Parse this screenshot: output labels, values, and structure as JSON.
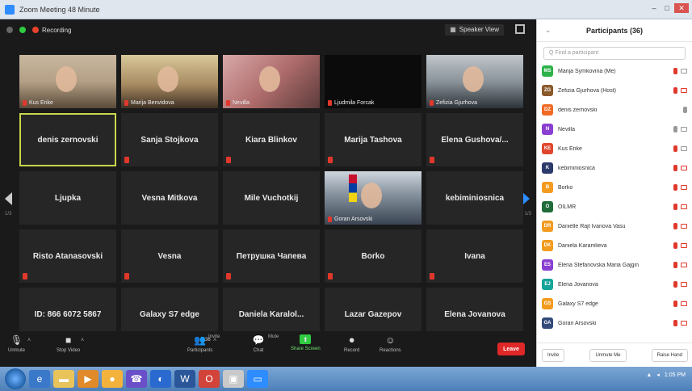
{
  "window": {
    "title": "Zoom Meeting 48 Minute"
  },
  "top": {
    "recording_label": "Recording",
    "speaker_view_label": "Speaker View"
  },
  "tiles": [
    {
      "name": "Kus Erike",
      "type": "video"
    },
    {
      "name": "Marija Benvidova",
      "type": "video"
    },
    {
      "name": "Nevilla",
      "type": "video"
    },
    {
      "name": "Ljudmila Forcak",
      "type": "video"
    },
    {
      "name": "Zefizia Gjurhova",
      "type": "video"
    },
    {
      "name": "denis zernovski",
      "type": "name",
      "active": true
    },
    {
      "name": "Sanja Stojkova",
      "type": "name",
      "muted": true
    },
    {
      "name": "Kiara Blinkov",
      "type": "name",
      "muted": true
    },
    {
      "name": "Marija Tashova",
      "type": "name",
      "muted": true
    },
    {
      "name": "Elena Gushova/...",
      "type": "name",
      "muted": true
    },
    {
      "name": "Ljupka",
      "type": "name"
    },
    {
      "name": "Vesna Mitkova",
      "type": "name"
    },
    {
      "name": "Mile Vuchotkij",
      "type": "name"
    },
    {
      "name": "Goran Arsovski",
      "type": "video"
    },
    {
      "name": "kebiminiosnica",
      "type": "name"
    },
    {
      "name": "Risto Atanasovski",
      "type": "name",
      "muted": true
    },
    {
      "name": "Vesna",
      "type": "name",
      "muted": true
    },
    {
      "name": "Петрушка Чапева",
      "type": "name",
      "muted": true
    },
    {
      "name": "Borko",
      "type": "name",
      "muted": true
    },
    {
      "name": "Ivana",
      "type": "name",
      "muted": true
    },
    {
      "name": "ID: 866 6072 5867",
      "type": "name",
      "muted": true
    },
    {
      "name": "Galaxy S7 edge",
      "type": "name",
      "muted": true
    },
    {
      "name": "Daniela Karalol...",
      "type": "name",
      "muted": true
    },
    {
      "name": "Lazar Gazepov",
      "type": "name",
      "muted": true
    },
    {
      "name": "Elena Jovanova",
      "type": "name",
      "muted": true
    }
  ],
  "pages": {
    "left": "1/3",
    "right": "1/3"
  },
  "toolbar": {
    "unmute": "Unmute",
    "stop_video": "Stop Video",
    "participants": "Participants",
    "participants_count": "36",
    "chat": "Chat",
    "share_screen": "Share Screen",
    "record": "Record",
    "reactions": "Reactions",
    "leave": "Leave",
    "hint_left": "Invite",
    "hint_right": "Mute"
  },
  "panel": {
    "title": "Participants (36)",
    "search_placeholder": "Q Find a participant",
    "participants": [
      {
        "name": "Marija Symkovina (Me)",
        "initials": "MS",
        "color": "#2db34a",
        "mic": "off",
        "cam": "on"
      },
      {
        "name": "Zefizia Gjurhova (Host)",
        "initials": "ZG",
        "color": "#8b5a2b",
        "mic": "off",
        "cam": "off",
        "photo": true
      },
      {
        "name": "denis zernovski",
        "initials": "DZ",
        "color": "#f06a24",
        "mic": "on",
        "cam": "none"
      },
      {
        "name": "Nevilla",
        "initials": "N",
        "color": "#8a3fd1",
        "mic": "on",
        "cam": "on"
      },
      {
        "name": "Kus Erike",
        "initials": "KE",
        "color": "#e0462c",
        "mic": "off",
        "cam": "on"
      },
      {
        "name": "kebiminiosnica",
        "initials": "K",
        "color": "#2b3a6b",
        "mic": "off",
        "cam": "off"
      },
      {
        "name": "Borko",
        "initials": "B",
        "color": "#f29b1f",
        "mic": "off",
        "cam": "off"
      },
      {
        "name": "OILMR",
        "initials": "O",
        "color": "#1f6b3a",
        "mic": "off",
        "cam": "off",
        "photo": true
      },
      {
        "name": "Danielle Rajt Ivanova Vasu",
        "initials": "DR",
        "color": "#f29b1f",
        "mic": "off",
        "cam": "off"
      },
      {
        "name": "Daniela Karamlieva",
        "initials": "DK",
        "color": "#f29b1f",
        "mic": "off",
        "cam": "off"
      },
      {
        "name": "Elena Stefanovska Maria Gajgin",
        "initials": "ES",
        "color": "#8a3fd1",
        "mic": "off",
        "cam": "off"
      },
      {
        "name": "Elena Jovanova",
        "initials": "EJ",
        "color": "#16a39a",
        "mic": "off",
        "cam": "off"
      },
      {
        "name": "Galaxy S7 edge",
        "initials": "GS",
        "color": "#f29b1f",
        "mic": "off",
        "cam": "off"
      },
      {
        "name": "Goran Arsovski",
        "initials": "GA",
        "color": "#334a7a",
        "mic": "off",
        "cam": "off",
        "photo": true
      }
    ],
    "footer": {
      "invite": "Invite",
      "mute_all": "Unmute Me",
      "raise_hand": "Raise Hand"
    }
  },
  "taskbar": {
    "clock": "1:05 PM"
  }
}
